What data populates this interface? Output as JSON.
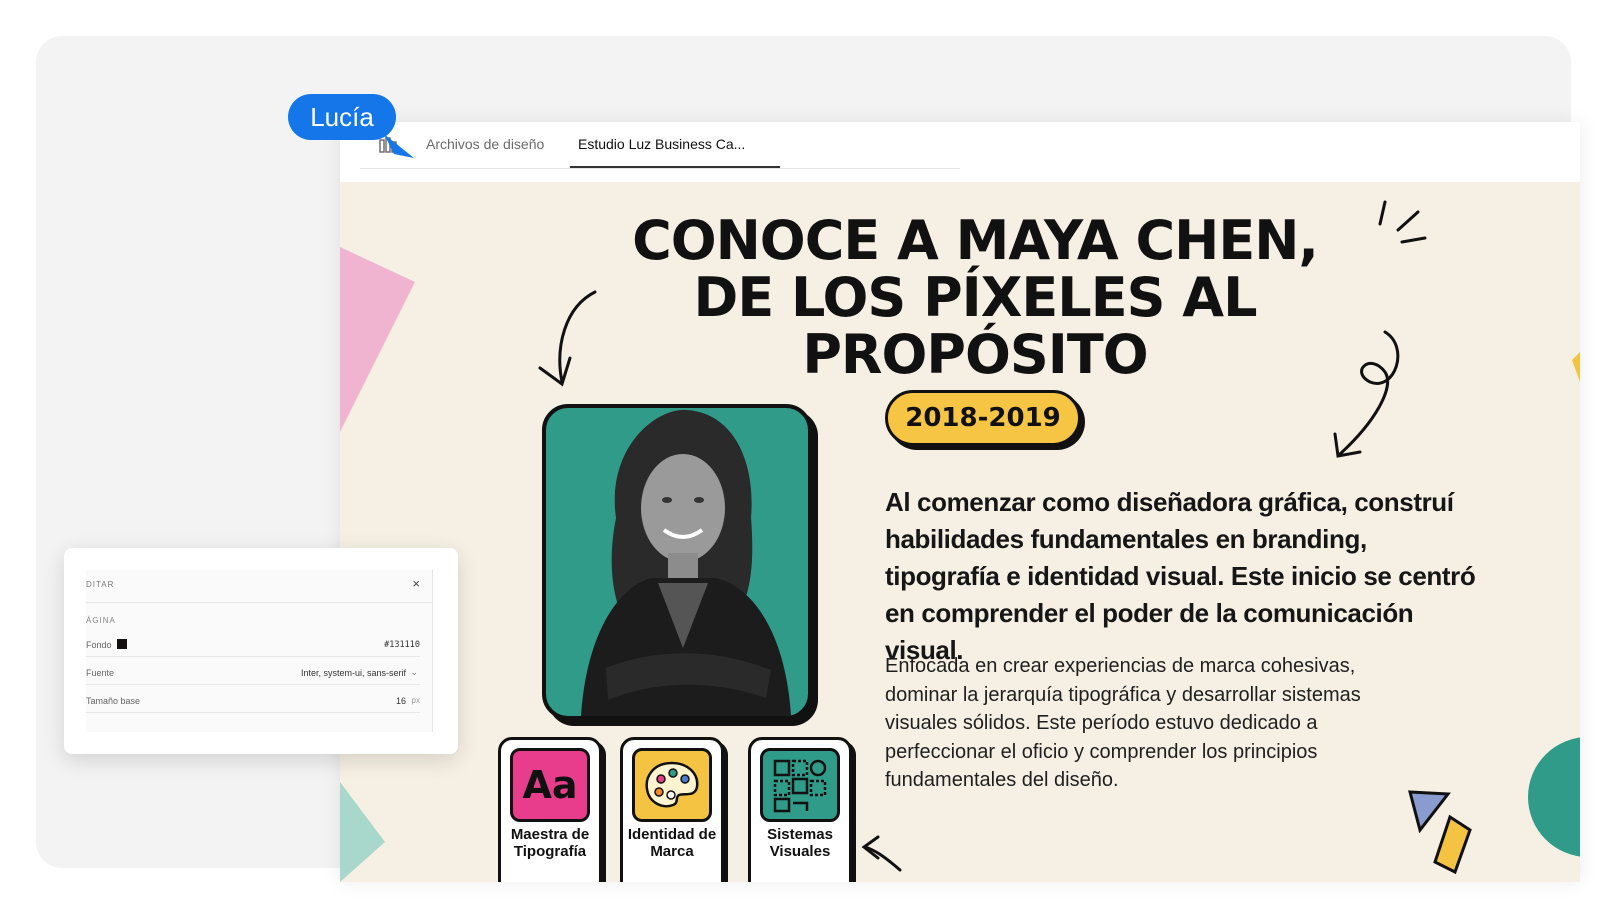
{
  "collaborator": {
    "name": "Lucía",
    "color": "#1476e8"
  },
  "tabs": [
    {
      "label": "Archivos de diseño"
    },
    {
      "label": "Estudio Luz Business Ca..."
    }
  ],
  "slide": {
    "headline_lines": [
      "CONOCE A MAYA CHEN,",
      "DE LOS PÍXELES AL",
      "PROPÓSITO"
    ],
    "year_range": "2018-2019",
    "lead_paragraph": "Al comenzar como diseñadora gráfica, construí habilidades fundamentales en branding, tipografía e identidad visual. Este inicio se centró en comprender el poder de la comunicación visual.",
    "body_paragraph": "Enfocada en crear experiencias de marca cohesivas, dominar la jerarquía tipográfica y desarrollar sistemas visuales sólidos. Este período estuvo dedicado a perfeccionar el oficio y comprender los principios fundamentales del diseño.",
    "skills": [
      {
        "label": "Maestra de Tipografía",
        "icon": "typography-aa-icon",
        "color": "#e83d8c",
        "icon_text": "Aa"
      },
      {
        "label": "Identidad de Marca",
        "icon": "palette-icon",
        "color": "#f5c342"
      },
      {
        "label": "Sistemas Visuales",
        "icon": "grid-system-icon",
        "color": "#2f9b88"
      }
    ],
    "background_color": "#f6f0e4",
    "accent_teal": "#2f9b88",
    "accent_yellow": "#f7c544",
    "accent_pink": "#f0b4d0"
  },
  "edit_panel": {
    "title": "DITAR",
    "section": "ÁGINA",
    "fields": [
      {
        "label": "Fondo",
        "value": "#131110",
        "swatch": "#131110"
      },
      {
        "label": "Fuente",
        "value": "Inter, system-ui, sans-serif"
      },
      {
        "label": "Tamaño base",
        "value": "16",
        "unit": "px"
      }
    ]
  }
}
